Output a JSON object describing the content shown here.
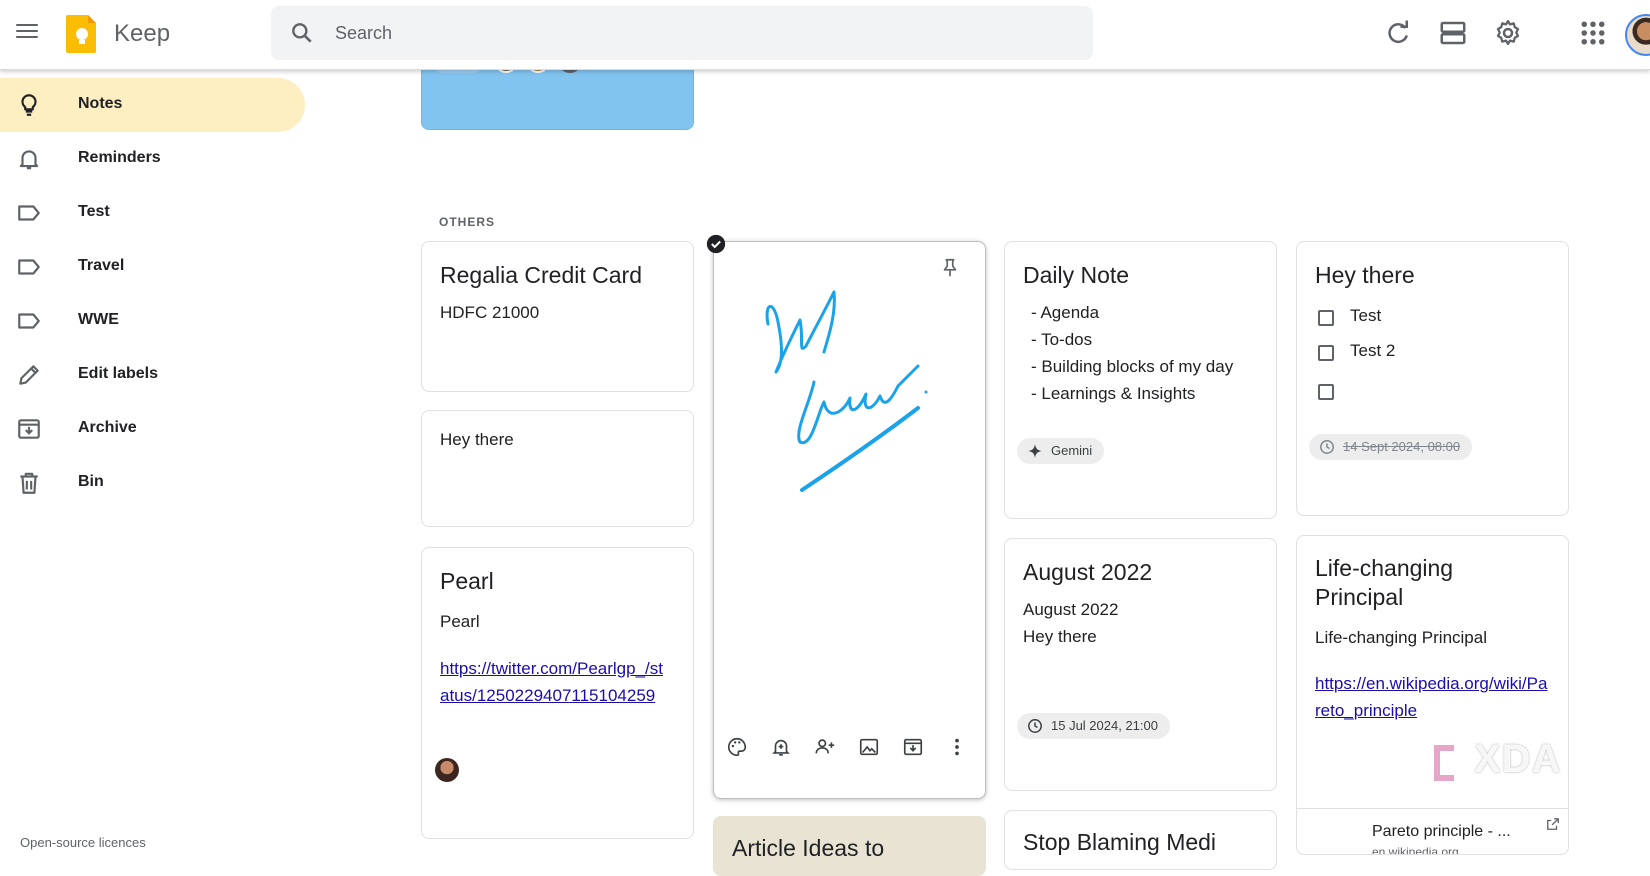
{
  "app": {
    "name": "Keep"
  },
  "search": {
    "placeholder": "Search"
  },
  "header_icons": [
    "refresh-icon",
    "list-view-icon",
    "settings-icon",
    "apps-grid-icon"
  ],
  "sidebar": {
    "items": [
      {
        "label": "Notes",
        "icon": "lightbulb-icon",
        "active": true
      },
      {
        "label": "Reminders",
        "icon": "bell-icon"
      },
      {
        "label": "Test",
        "icon": "label-icon"
      },
      {
        "label": "Travel",
        "icon": "label-icon"
      },
      {
        "label": "WWE",
        "icon": "label-icon"
      },
      {
        "label": "Edit labels",
        "icon": "pencil-icon"
      },
      {
        "label": "Archive",
        "icon": "archive-icon"
      },
      {
        "label": "Bin",
        "icon": "bin-icon"
      }
    ],
    "footer": "Open-source licences"
  },
  "section": {
    "others_label": "OTHERS"
  },
  "notes": {
    "regalia": {
      "title": "Regalia Credit Card",
      "body": "HDFC 21000"
    },
    "hey1": {
      "body": "Hey there"
    },
    "pearl": {
      "title": "Pearl",
      "body": "Pearl",
      "link_line1": "https://twitter.com/Pearlgp_/st",
      "link_line2": "atus/1250229407115104259"
    },
    "daily": {
      "title": "Daily Note",
      "items": [
        "- Agenda",
        "- To-dos",
        "- Building blocks of my day",
        "- Learnings & Insights"
      ],
      "chip": "Gemini"
    },
    "hey2": {
      "title": "Hey there",
      "checklist": [
        "Test",
        "Test 2",
        ""
      ],
      "reminder": "14 Sept 2024, 08:00"
    },
    "august": {
      "title": "August 2022",
      "line1": "August 2022",
      "line2": "Hey there",
      "reminder": "15 Jul 2024, 21:00"
    },
    "life": {
      "title_line1": "Life-changing",
      "title_line2": "Principal",
      "body": "Life-changing Principal",
      "link_line1": "https://en.wikipedia.org/wiki/Pa",
      "link_line2": "reto_principle",
      "preview_title": "Pareto principle - ...",
      "preview_domain": "en.wikipedia.org"
    },
    "article": {
      "title": "Article Ideas to"
    },
    "stop": {
      "title": "Stop Blaming Medi"
    }
  },
  "watermark": "XDA",
  "colors": {
    "active_nav": "#feefc3",
    "blue_note": "#82c4f0",
    "article_note": "#e9e3d4",
    "ink": "#1aa3e8"
  }
}
